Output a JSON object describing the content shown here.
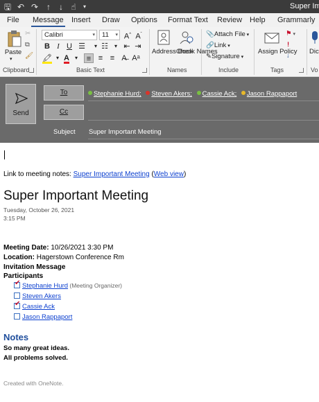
{
  "titlebar": {
    "title": "Super Imp"
  },
  "tabs": [
    "File",
    "Message",
    "Insert",
    "Draw",
    "Options",
    "Format Text",
    "Review",
    "Help",
    "Grammarly"
  ],
  "active_tab": "Message",
  "ribbon": {
    "clipboard": {
      "paste_label": "Paste",
      "group": "Clipboard"
    },
    "basic_text": {
      "font": "Calibri",
      "size": "11",
      "group": "Basic Text"
    },
    "names": {
      "address_book": "Address Book",
      "check_names": "Check Names",
      "group": "Names"
    },
    "include": {
      "attach_file": "Attach File",
      "link": "Link",
      "signature": "Signature",
      "group": "Include"
    },
    "tags": {
      "assign_policy": "Assign Policy",
      "group": "Tags"
    },
    "voice": {
      "dictate": "Dict",
      "group": "Vo"
    }
  },
  "compose": {
    "send_label": "Send",
    "to_label": "To",
    "cc_label": "Cc",
    "subject_label": "Subject",
    "subject_value": "Super Important Meeting",
    "recipients": [
      {
        "name": "Stephanie Hurd;",
        "status_color": "#7ac142"
      },
      {
        "name": "Steven Akers;",
        "status_color": "#d9342b"
      },
      {
        "name": "Cassie Ack;",
        "status_color": "#7ac142"
      },
      {
        "name": "Jason Rappaport",
        "status_color": "#e8b92a"
      }
    ]
  },
  "body": {
    "link_prefix": "Link to meeting notes: ",
    "link_text": "Super Important Meeting",
    "web_view_open": " (",
    "web_view": "Web view",
    "web_view_close": ")",
    "heading": "Super Important Meeting",
    "date": "Tuesday, October 26, 2021",
    "time": "3:15 PM",
    "meeting_date_label": "Meeting Date:",
    "meeting_date_value": " 10/26/2021 3:30 PM",
    "location_label": "Location:",
    "location_value": " Hagerstown Conference Rm",
    "invitation": "Invitation Message",
    "participants_label": "Participants",
    "participants": [
      {
        "name": "Stephanie Hurd",
        "note": " (Meeting Organizer)",
        "checked": true
      },
      {
        "name": "Steven Akers",
        "note": "",
        "checked": false
      },
      {
        "name": "Cassie Ack",
        "note": "",
        "checked": true
      },
      {
        "name": "Jason Rappaport",
        "note": "",
        "checked": false
      }
    ],
    "notes_heading": "Notes",
    "notes": [
      "So many great ideas.",
      "All problems solved."
    ],
    "footer": "Created with OneNote."
  },
  "colors": {
    "accent": "#2b579a",
    "link": "#0b3fcf",
    "notes_heading": "#1f4e9c"
  }
}
